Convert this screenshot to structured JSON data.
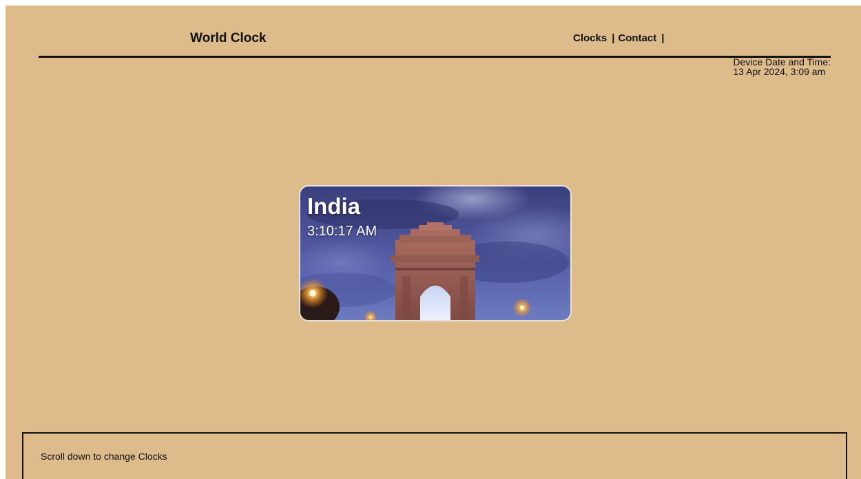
{
  "header": {
    "title": "World Clock",
    "nav": [
      {
        "label": "Clocks",
        "separator": "|"
      },
      {
        "label": "Contact",
        "separator": "|"
      }
    ]
  },
  "device_time": {
    "label": "Device Date and Time:",
    "value": "13 Apr 2024, 3:09 am"
  },
  "clock": {
    "country": "India",
    "time": "3:10:17 AM",
    "image": "india-gate-icon"
  },
  "footer": {
    "hint": "Scroll down to change Clocks"
  },
  "colors": {
    "background": "#debb8a",
    "text": "#111111"
  }
}
